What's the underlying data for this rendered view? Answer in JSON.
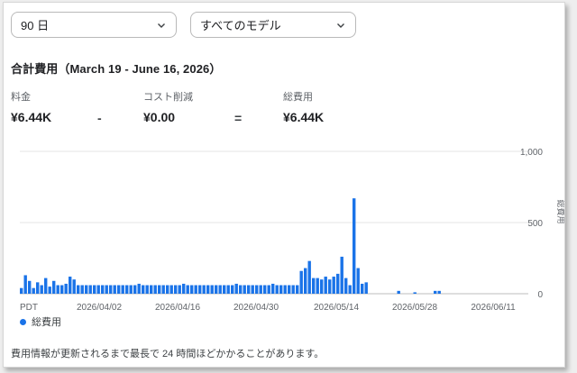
{
  "filters": {
    "period": "90 日",
    "model": "すべてのモデル"
  },
  "title": "合計費用（March 19 - June 16, 2026）",
  "metrics": {
    "charge_label": "料金",
    "charge_value": "¥6.44K",
    "minus": "-",
    "savings_label": "コスト削減",
    "savings_value": "¥0.00",
    "equals": "=",
    "total_label": "総費用",
    "total_value": "¥6.44K"
  },
  "legend_label": "総費用",
  "footnote": "費用情報が更新されるまで最長で 24 時間ほどかかることがあります。",
  "colors": {
    "bar": "#1a73e8",
    "grid": "#e6e6e6"
  },
  "chart_data": {
    "type": "bar",
    "title": "",
    "xlabel": "",
    "ylabel": "総費用",
    "ylim": [
      0,
      1000
    ],
    "y_ticks": [
      "0",
      "500",
      "1,000"
    ],
    "x_ticks": [
      "PDT",
      "2026/04/02",
      "2026/04/16",
      "2026/04/30",
      "2026/05/14",
      "2026/05/28",
      "2026/06/11"
    ],
    "x_start": "2026-03-19",
    "series": [
      {
        "name": "総費用",
        "values": [
          40,
          130,
          90,
          40,
          80,
          60,
          110,
          50,
          90,
          60,
          60,
          70,
          120,
          100,
          60,
          60,
          60,
          60,
          60,
          60,
          60,
          60,
          60,
          60,
          60,
          60,
          60,
          60,
          60,
          70,
          60,
          60,
          60,
          60,
          60,
          60,
          60,
          60,
          60,
          60,
          70,
          60,
          60,
          60,
          60,
          60,
          60,
          60,
          60,
          60,
          60,
          60,
          60,
          70,
          60,
          60,
          60,
          60,
          60,
          60,
          60,
          60,
          70,
          60,
          60,
          60,
          60,
          60,
          60,
          160,
          180,
          230,
          110,
          110,
          100,
          120,
          100,
          120,
          140,
          260,
          110,
          60,
          670,
          180,
          70,
          80,
          0,
          0,
          0,
          0,
          0,
          0,
          0,
          20,
          0,
          0,
          0,
          10,
          0,
          0,
          0,
          0,
          20,
          20,
          0,
          0,
          0,
          0,
          0,
          0,
          0,
          0,
          0,
          0,
          0,
          0,
          0,
          0,
          0,
          0,
          0,
          0,
          0,
          0,
          0,
          0,
          0,
          0,
          0,
          0,
          0,
          0,
          0,
          0,
          0,
          0,
          0,
          0,
          0,
          0,
          0,
          0,
          0,
          0,
          0,
          0,
          0,
          0,
          0,
          0,
          0,
          0,
          0,
          0,
          0,
          0,
          0,
          0,
          0,
          0,
          0,
          0,
          0,
          0,
          0,
          0,
          0,
          0,
          0,
          0,
          0,
          0,
          0,
          0,
          0,
          0,
          0,
          0,
          0,
          0,
          0,
          0,
          0,
          0,
          0,
          0,
          0,
          0,
          0,
          0,
          0,
          0,
          0,
          0,
          0,
          0,
          0,
          0,
          0,
          0
        ]
      }
    ]
  }
}
